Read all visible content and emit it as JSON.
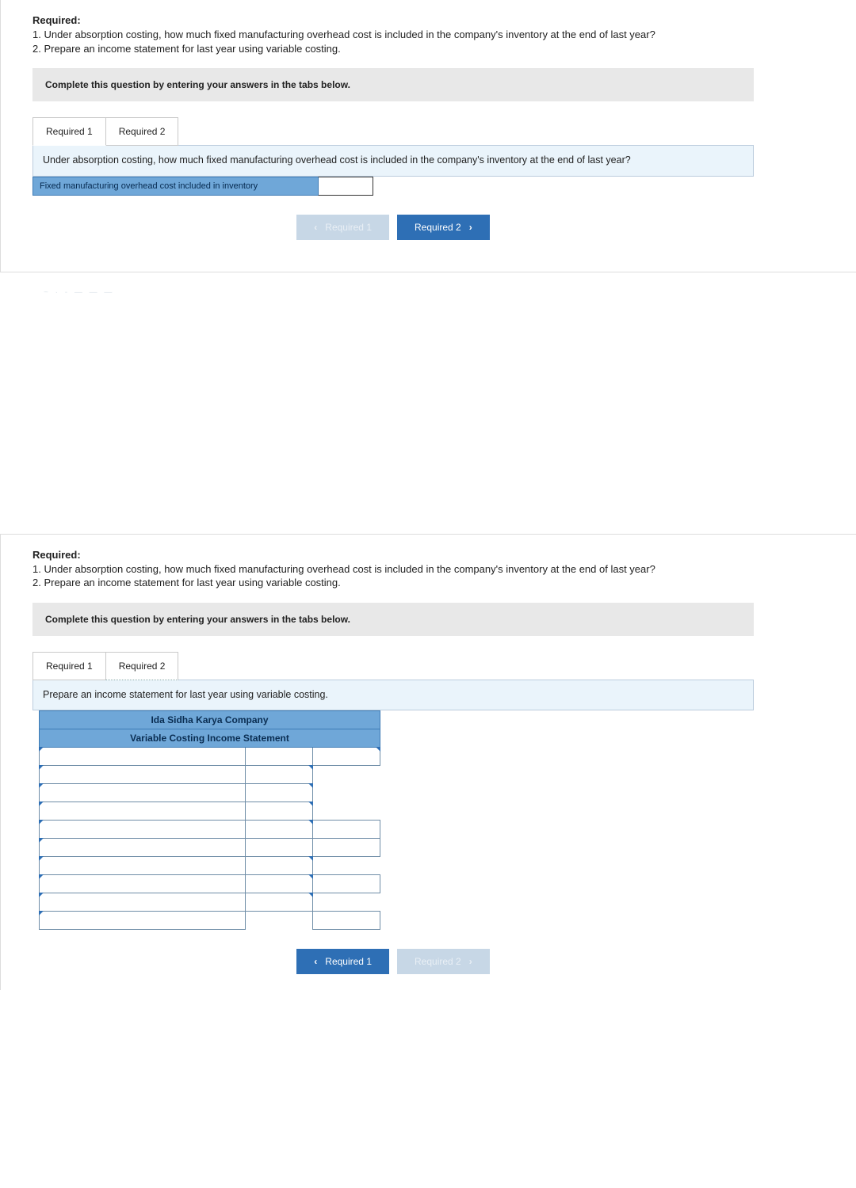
{
  "required": {
    "heading": "Required:",
    "q1": "1. Under absorption costing, how much fixed manufacturing overhead cost is included in the company's inventory at the end of last year?",
    "q2": "2. Prepare an income statement for last year using variable costing."
  },
  "instruction": "Complete this question by entering your answers in the tabs below.",
  "tabs": {
    "r1": "Required 1",
    "r2": "Required 2"
  },
  "panel1": {
    "prompt": "Under absorption costing, how much fixed manufacturing overhead cost is included in the company's inventory at the end of last year?",
    "row_label": "Fixed manufacturing overhead cost included in inventory"
  },
  "panel2": {
    "prompt": "Prepare an income statement for last year using variable costing.",
    "header1": "Ida Sidha Karya Company",
    "header2": "Variable Costing Income Statement"
  },
  "nav": {
    "req1": "Required 1",
    "req2": "Required 2"
  }
}
